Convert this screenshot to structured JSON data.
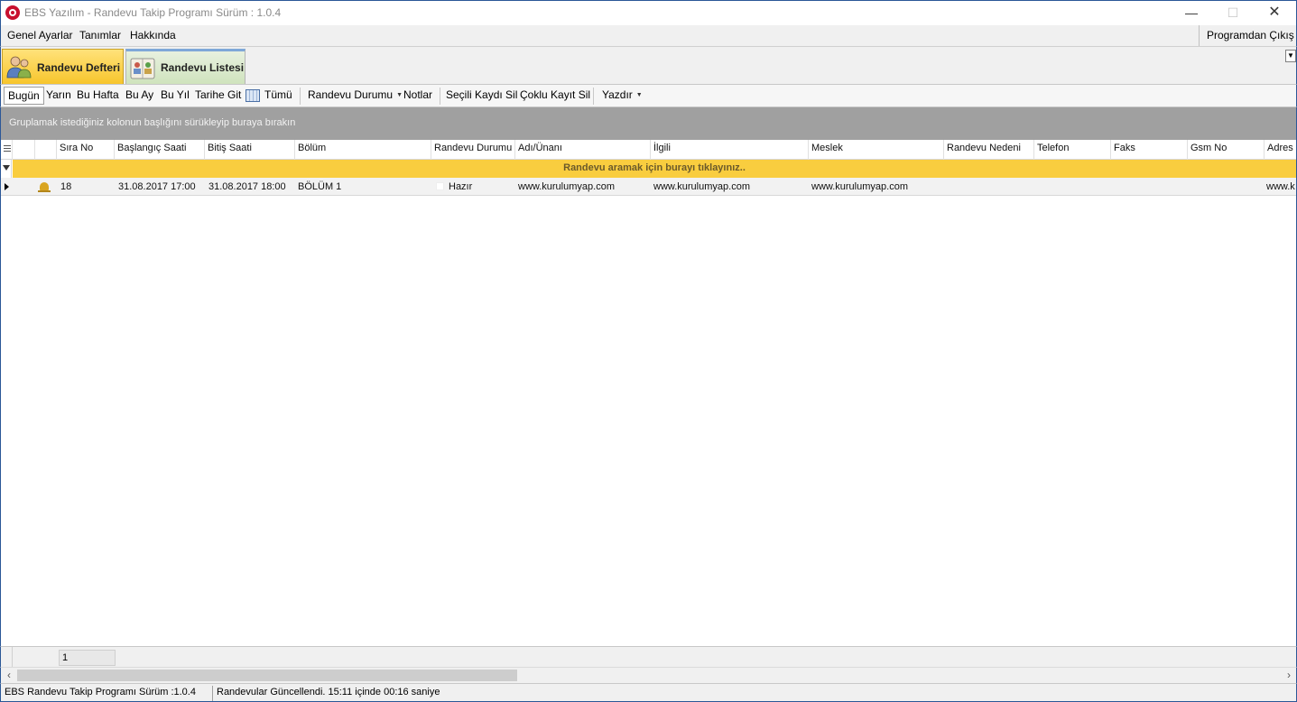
{
  "window": {
    "title": "EBS Yazılım - Randevu Takip Programı Sürüm : 1.0.4",
    "minimize": "—",
    "maximize": "☐",
    "close": "✕"
  },
  "menu": {
    "items": [
      "Genel Ayarlar",
      "Tanımlar",
      "Hakkında"
    ],
    "exit": "Programdan Çıkış"
  },
  "tabs": [
    {
      "label": "Randevu Defteri",
      "icon": "people-icon",
      "active": true
    },
    {
      "label": "Randevu Listesi",
      "icon": "book-people-icon",
      "active": false
    }
  ],
  "toolbar": {
    "today": "Bugün",
    "tomorrow": "Yarın",
    "this_week": "Bu Hafta",
    "this_month": "Bu Ay",
    "this_year": "Bu Yıl",
    "go_to_date": "Tarihe Git",
    "all": "Tümü",
    "status": "Randevu Durumu",
    "notes": "Notlar",
    "delete_selected": "Seçili Kaydı Sil",
    "delete_multiple": "Çoklu Kayıt Sil",
    "print": "Yazdır"
  },
  "group_panel": {
    "hint": "Gruplamak istediğiniz kolonun başlığını sürükleyip buraya bırakın"
  },
  "grid": {
    "columns": [
      "Sıra No",
      "Başlangıç Saati",
      "Bitiş Saati",
      "Bölüm",
      "Randevu Durumu",
      "Adı/Ünanı",
      "İlgili",
      "Meslek",
      "Randevu Nedeni",
      "Telefon",
      "Faks",
      "Gsm No",
      "Adres"
    ],
    "filter_prompt": "Randevu aramak için burayı tıklayınız..",
    "rows": [
      {
        "sira_no": "18",
        "baslangic": "31.08.2017 17:00",
        "bitis": "31.08.2017 18:00",
        "bolum": "BÖLÜM 1",
        "durum": "Hazır",
        "adi": "www.kurulumyap.com",
        "ilgili": "www.kurulumyap.com",
        "meslek": "www.kurulumyap.com",
        "nedeni": "",
        "telefon": "",
        "faks": "",
        "gsm": "",
        "adres": "www.k"
      }
    ]
  },
  "footer": {
    "page": "1"
  },
  "statusbar": {
    "version": "EBS Randevu Takip  Programı Sürüm :1.0.4",
    "message": "Randevular Güncellendi.  15:11  içinde 00:16 saniye"
  },
  "colors": {
    "accent_border": "#2b5797",
    "filter_bar": "#f9cd3f",
    "group_panel": "#a0a0a0",
    "active_tab": "#f7c52c"
  }
}
